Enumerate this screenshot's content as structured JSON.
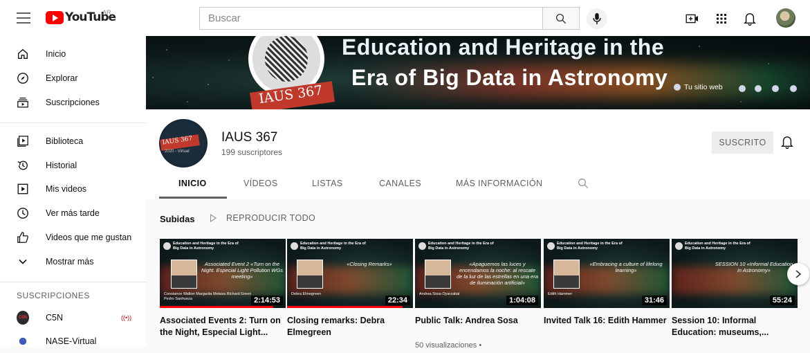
{
  "header": {
    "logo_text": "YouTube",
    "region": "AR",
    "search_placeholder": "Buscar"
  },
  "sidebar": {
    "items": [
      {
        "label": "Inicio",
        "icon": "home-icon"
      },
      {
        "label": "Explorar",
        "icon": "compass-icon"
      },
      {
        "label": "Suscripciones",
        "icon": "subscriptions-icon"
      },
      {
        "label": "Biblioteca",
        "icon": "library-icon"
      },
      {
        "label": "Historial",
        "icon": "history-icon"
      },
      {
        "label": "Mis videos",
        "icon": "my-videos-icon"
      },
      {
        "label": "Ver más tarde",
        "icon": "watch-later-icon"
      },
      {
        "label": "Videos que me gustan",
        "icon": "thumb-up-icon"
      },
      {
        "label": "Mostrar más",
        "icon": "chevron-down-icon"
      }
    ],
    "subscriptions_header": "SUSCRIPCIONES",
    "subscriptions": [
      {
        "label": "C5N",
        "live": "((•))"
      },
      {
        "label": "NASE-Virtual"
      }
    ]
  },
  "banner": {
    "title_line1": "Education and Heritage in the",
    "title_line2": "Era of Big Data in Astronomy",
    "tag": "IAUS 367",
    "website_label": "Tu sitio web"
  },
  "channel": {
    "name": "IAUS 367",
    "subscribers": "199 suscriptores",
    "subscribed_label": "SUSCRITO",
    "avatar_tag": "IAUS 367",
    "avatar_sub": "2020 - Virtual"
  },
  "tabs": [
    "INICIO",
    "VÍDEOS",
    "LISTAS",
    "CANALES",
    "MÁS INFORMACIÓN"
  ],
  "section": {
    "title": "Subidas",
    "play_all": "REPRODUCIR TODO"
  },
  "videos": [
    {
      "title": "Associated Events 2: Turn on the Night, Especial Light...",
      "duration": "2:14:53",
      "progress": 0.9,
      "thumb_quote": "Associated Event 2 «Turn on the Night. Especial Light Pollution WGs meeting»",
      "thumb_caption": "Constance Walker Margarita Metaxa Richard Green Pedro Sanhueza",
      "meta": ""
    },
    {
      "title": "Closing remarks: Debra Elmegreen",
      "duration": "22:34",
      "progress": 0.92,
      "thumb_quote": "«Closing Remarks»",
      "thumb_caption": "Debra Elmegreen",
      "meta": ""
    },
    {
      "title": "Public Talk: Andrea Sosa",
      "duration": "1:04:08",
      "progress": 0,
      "thumb_quote": "«Apaguemos las luces y encendamos la noche: al rescate de la luz de las estrellas en una era de iluminación artificial»",
      "thumb_caption": "Andrea Sosa Oyarzabal",
      "meta": "50 visualizaciones •"
    },
    {
      "title": "Invited Talk 16: Edith Hammer",
      "duration": "31:46",
      "progress": 0,
      "thumb_quote": "«Embracing a culture of lifelong learning»",
      "thumb_caption": "Edith Hammer",
      "meta": ""
    },
    {
      "title": "Session 10: Informal Education: museums,...",
      "duration": "55:24",
      "progress": 0,
      "thumb_quote": "SESSION 10 «Informal Education in Astronomy»",
      "thumb_caption": "",
      "meta": ""
    }
  ],
  "thumb_header": "Education and Heritage in the Era of Big Data in Astronomy",
  "colors": {
    "brand_red": "#ff0000",
    "text_primary": "#0f0f0f",
    "text_secondary": "#606060"
  }
}
